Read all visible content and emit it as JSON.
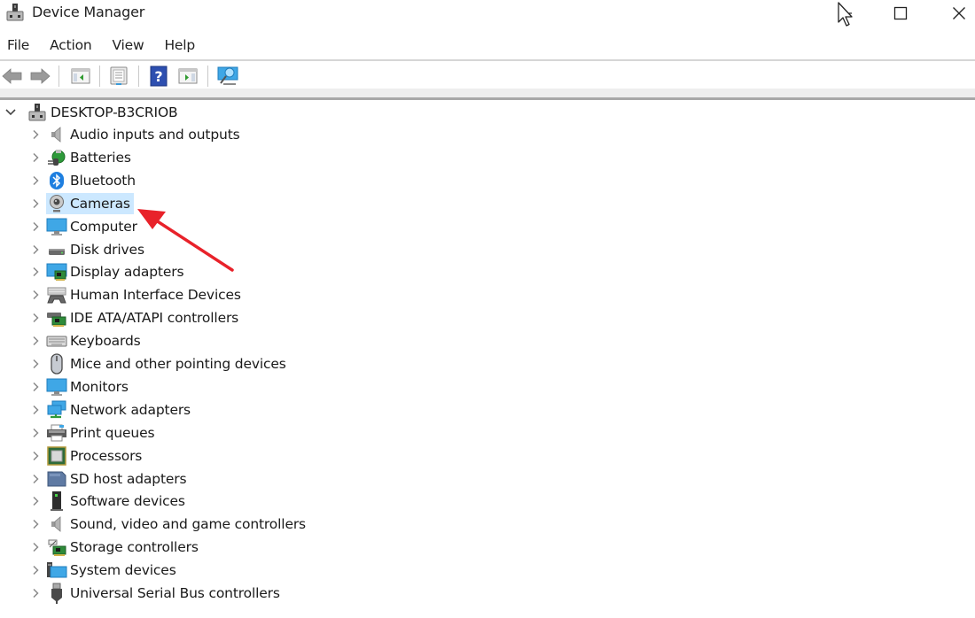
{
  "window": {
    "title": "Device Manager",
    "icons": {
      "app": "device-manager-icon",
      "minimize": "minimize-icon",
      "maximize": "maximize-icon",
      "close": "close-icon",
      "cursor": "mouse-pointer-icon"
    }
  },
  "menu": {
    "items": [
      {
        "label": "File"
      },
      {
        "label": "Action"
      },
      {
        "label": "View"
      },
      {
        "label": "Help"
      }
    ]
  },
  "toolbar": {
    "buttons": [
      {
        "name": "back",
        "icon": "back-arrow-icon",
        "enabled": false
      },
      {
        "name": "forward",
        "icon": "forward-arrow-icon",
        "enabled": false
      },
      {
        "name": "show-hide-console-tree",
        "icon": "console-tree-icon"
      },
      {
        "name": "properties",
        "icon": "properties-icon"
      },
      {
        "name": "help",
        "icon": "help-icon"
      },
      {
        "name": "show-hide-action-pane",
        "icon": "action-pane-icon"
      },
      {
        "name": "scan-for-hardware-changes",
        "icon": "scan-hardware-icon"
      }
    ]
  },
  "tree": {
    "root": {
      "label": "DESKTOP-B3CRIOB",
      "expanded": true,
      "icon": "computer-tower-icon"
    },
    "children": [
      {
        "label": "Audio inputs and outputs",
        "icon": "speaker-icon"
      },
      {
        "label": "Batteries",
        "icon": "battery-icon"
      },
      {
        "label": "Bluetooth",
        "icon": "bluetooth-icon"
      },
      {
        "label": "Cameras",
        "icon": "webcam-icon",
        "selected": true
      },
      {
        "label": "Computer",
        "icon": "monitor-icon"
      },
      {
        "label": "Disk drives",
        "icon": "disk-drive-icon"
      },
      {
        "label": "Display adapters",
        "icon": "display-adapter-icon"
      },
      {
        "label": "Human Interface Devices",
        "icon": "hid-icon"
      },
      {
        "label": "IDE ATA/ATAPI controllers",
        "icon": "ide-controller-icon"
      },
      {
        "label": "Keyboards",
        "icon": "keyboard-icon"
      },
      {
        "label": "Mice and other pointing devices",
        "icon": "mouse-icon"
      },
      {
        "label": "Monitors",
        "icon": "monitor-icon"
      },
      {
        "label": "Network adapters",
        "icon": "network-adapter-icon"
      },
      {
        "label": "Print queues",
        "icon": "printer-icon"
      },
      {
        "label": "Processors",
        "icon": "processor-icon"
      },
      {
        "label": "SD host adapters",
        "icon": "sd-card-icon"
      },
      {
        "label": "Software devices",
        "icon": "software-device-icon"
      },
      {
        "label": "Sound, video and game controllers",
        "icon": "speaker-icon"
      },
      {
        "label": "Storage controllers",
        "icon": "storage-controller-icon"
      },
      {
        "label": "System devices",
        "icon": "system-devices-icon"
      },
      {
        "label": "Universal Serial Bus controllers",
        "icon": "usb-icon"
      }
    ]
  },
  "annotation": {
    "type": "arrow",
    "color": "#e8222a",
    "points_to": "Cameras"
  },
  "colors": {
    "selection": "#cce8ff",
    "annotation": "#e8222a"
  }
}
